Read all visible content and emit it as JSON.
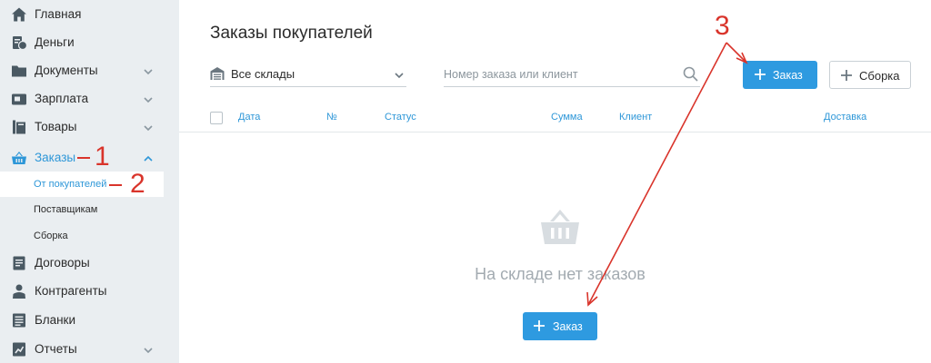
{
  "sidebar": {
    "items": [
      {
        "label": "Главная",
        "icon": "home-icon"
      },
      {
        "label": "Деньги",
        "icon": "money-icon"
      },
      {
        "label": "Документы",
        "icon": "folder-icon"
      },
      {
        "label": "Зарплата",
        "icon": "wallet-icon"
      },
      {
        "label": "Товары",
        "icon": "box-icon"
      },
      {
        "label": "Заказы",
        "icon": "basket-icon"
      },
      {
        "label": "Договоры",
        "icon": "contract-icon"
      },
      {
        "label": "Контрагенты",
        "icon": "people-icon"
      },
      {
        "label": "Бланки",
        "icon": "forms-icon"
      },
      {
        "label": "Отчеты",
        "icon": "report-icon"
      }
    ],
    "sub_items": [
      {
        "label": "От покупателей"
      },
      {
        "label": "Поставщикам"
      },
      {
        "label": "Сборка"
      }
    ]
  },
  "main": {
    "title": "Заказы покупателей",
    "warehouse": "Все склады",
    "search_placeholder": "Номер заказа или клиент",
    "order_button": "Заказ",
    "assembly_button": "Сборка",
    "columns": [
      "Дата",
      "№",
      "Статус",
      "Сумма",
      "Клиент",
      "Доставка"
    ],
    "empty_text": "На складе нет заказов",
    "empty_order_button": "Заказ"
  },
  "annotations": [
    "1",
    "2",
    "3"
  ],
  "colors": {
    "accent": "#2e9ae0",
    "annotation": "#d9342b",
    "sidebar_bg": "#eaeef1"
  }
}
